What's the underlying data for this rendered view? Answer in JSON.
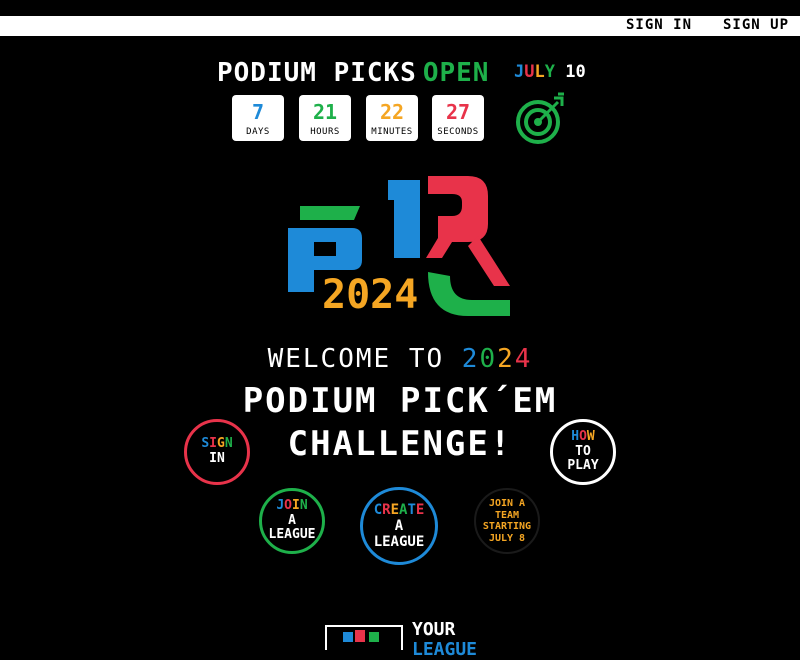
{
  "nav": {
    "sign_in": "SIGN IN",
    "sign_up": "SIGN UP"
  },
  "countdown": {
    "title": "PODIUM PICKS",
    "status": "OPEN",
    "date_month": [
      "J",
      "U",
      "L",
      "Y"
    ],
    "date_day": "10",
    "units": [
      {
        "value": "7",
        "label": "DAYS",
        "color": "#1e8ad8"
      },
      {
        "value": "21",
        "label": "HOURS",
        "color": "#1eb04a"
      },
      {
        "value": "22",
        "label": "MINUTES",
        "color": "#f5a623"
      },
      {
        "value": "27",
        "label": "SECONDS",
        "color": "#e8334a"
      }
    ]
  },
  "logo": {
    "year": "2024"
  },
  "welcome": {
    "prefix": "WELCOME TO ",
    "year_digits": [
      "2",
      "0",
      "2",
      "4"
    ]
  },
  "headline": {
    "line1": "PODIUM PICK´EM",
    "line2": "CHALLENGE!"
  },
  "buttons": {
    "sign_in": {
      "line1": [
        "S",
        "I",
        "G",
        "N"
      ],
      "line2": "IN"
    },
    "how_to_play": {
      "line1": [
        "H",
        "O",
        "W"
      ],
      "line2": "TO",
      "line3": "PLAY"
    },
    "join_league": {
      "line1": [
        "J",
        "O",
        "I",
        "N"
      ],
      "line2": "A",
      "line3": "LEAGUE"
    },
    "create_league": {
      "line1": [
        "C",
        "R",
        "E",
        "A",
        "T",
        "E"
      ],
      "line2": "A",
      "line3": "LEAGUE"
    },
    "join_team": {
      "line1": "JOIN A TEAM",
      "line2": "STARTING",
      "line3": "JULY 8"
    }
  },
  "your_league": {
    "line1": "YOUR",
    "line2": "LEAGUE"
  },
  "colors": {
    "blue": "#1e8ad8",
    "green": "#1eb04a",
    "orange": "#f5a623",
    "red": "#e8334a",
    "background": "#000000"
  }
}
